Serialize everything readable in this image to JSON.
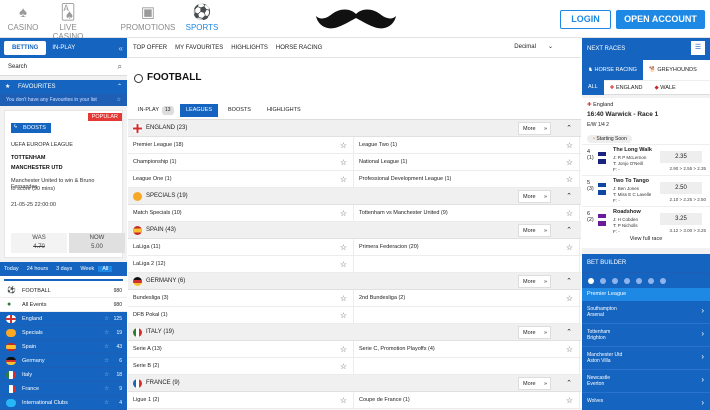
{
  "nav": {
    "items": [
      {
        "label": "CASINO",
        "icon": "spade-chip-icon"
      },
      {
        "label": "LIVE CASINO",
        "icon": "cards-icon"
      },
      {
        "label": "PROMOTIONS",
        "icon": "gift-icon"
      },
      {
        "label": "SPORTS",
        "icon": "soccer-ball-icon"
      }
    ],
    "login": "LOGIN",
    "open_account": "OPEN ACCOUNT"
  },
  "left": {
    "tabs": [
      "BETTING",
      "IN-PLAY"
    ],
    "collapse": "«",
    "search_label": "Search",
    "favourites_title": "FAVOURITES",
    "favourites_empty": "You don't have any Favourites in your list",
    "boost": {
      "popular": "POPULAR",
      "badge": "BOOSTS",
      "competition": "UEFA EUROPA LEAGUE",
      "team1": "TOTTENHAM",
      "team2": "MANCHESTER UTD",
      "desc1": "Manchester United to win & Bruno Fernandes",
      "desc2": "to score (90 mins)",
      "date": "21-05-25 22:00:00",
      "was_label": "WAS",
      "was_value": "4.70",
      "now_label": "NOW",
      "now_value": "5.00"
    },
    "time_tabs": [
      "Today",
      "24 hours",
      "3 days",
      "Week",
      "All"
    ],
    "sports": [
      {
        "label": "FOOTBALL",
        "count": "980"
      },
      {
        "label": "All Events",
        "count": "980"
      },
      {
        "label": "England",
        "count": "125"
      },
      {
        "label": "Specials",
        "count": "19"
      },
      {
        "label": "Spain",
        "count": "43"
      },
      {
        "label": "Germany",
        "count": "6"
      },
      {
        "label": "Italy",
        "count": "18"
      },
      {
        "label": "France",
        "count": "9"
      },
      {
        "label": "International Clubs",
        "count": "4"
      }
    ]
  },
  "mid": {
    "menu": [
      "TOP OFFER",
      "MY FAVOURITES",
      "HIGHLIGHTS",
      "HORSE RACING"
    ],
    "odds_format": "Decimal",
    "sport_title": "FOOTBALL",
    "tabs": {
      "inplay": "IN-PLAY",
      "inplay_count": "13",
      "leagues": "LEAGUES",
      "boosts": "BOOSTS",
      "highlights": "HIGHLIGHTS"
    },
    "more": "More",
    "countries": [
      {
        "name": "ENGLAND (23)",
        "rows": [
          [
            "Premier League (18)",
            "League Two (1)"
          ],
          [
            "Championship (1)",
            "National League (1)"
          ],
          [
            "League One (1)",
            "Professional Development League (1)"
          ]
        ]
      },
      {
        "name": "SPECIALS (19)",
        "rows": [
          [
            "Match Specials (10)",
            "Tottenham vs Manchester United (9)"
          ]
        ]
      },
      {
        "name": "SPAIN (43)",
        "rows": [
          [
            "LaLiga (11)",
            "Primera Federacion (20)"
          ],
          [
            "LaLiga 2 (12)",
            ""
          ]
        ]
      },
      {
        "name": "GERMANY (6)",
        "rows": [
          [
            "Bundesliga (3)",
            "2nd Bundesliga (2)"
          ],
          [
            "DFB Pokal (1)",
            ""
          ]
        ]
      },
      {
        "name": "ITALY (19)",
        "rows": [
          [
            "Serie A (13)",
            "Serie C, Promotion Playoffs (4)"
          ],
          [
            "Serie B (2)",
            ""
          ]
        ]
      },
      {
        "name": "FRANCE (9)",
        "rows": [
          [
            "Ligue 1 (2)",
            "Coupe de France (1)"
          ]
        ]
      }
    ]
  },
  "right": {
    "next_races": "NEXT RACES",
    "tab_horse": "HORSE RACING",
    "tab_grey": "GREYHOUNDS",
    "filters": [
      "ALL",
      "ENGLAND",
      "WALE"
    ],
    "race_country": "England",
    "race_title": "16:40 Warwick - Race 1",
    "race_terms": "E/W 1/4 2",
    "race_status": "Starting Soon",
    "runners": [
      {
        "num": "4",
        "draw": "(1)",
        "name": "The Long Walk",
        "j": "J: R P McLernon",
        "t": "T: Jonjo O'Neill",
        "f": "F: -",
        "price": "2.35",
        "hist": "2.90 > 2.55 > 2.35"
      },
      {
        "num": "5",
        "draw": "(3)",
        "name": "Two To Tango",
        "j": "J: Ben Jones",
        "t": "T: Miss E C Lavelle",
        "f": "F: -",
        "price": "2.50",
        "hist": "2.10 > 2.25 > 2.50"
      },
      {
        "num": "6",
        "draw": "(2)",
        "name": "Roadshow",
        "j": "J: H Cobden",
        "t": "T: P Nicholls",
        "f": "F: -",
        "price": "3.25",
        "hist": "3.12 > 3.00 > 3.25"
      }
    ],
    "view_full": "View full race",
    "bet_builder": "BET BUILDER",
    "bb_league": "Premier League",
    "bb_matches": [
      [
        "Southampton",
        "Arsenal"
      ],
      [
        "Tottenham",
        "Brighton"
      ],
      [
        "Manchester Utd",
        "Aston Villa"
      ],
      [
        "Newcastle",
        "Everton"
      ],
      [
        "Wolves",
        ""
      ]
    ]
  }
}
